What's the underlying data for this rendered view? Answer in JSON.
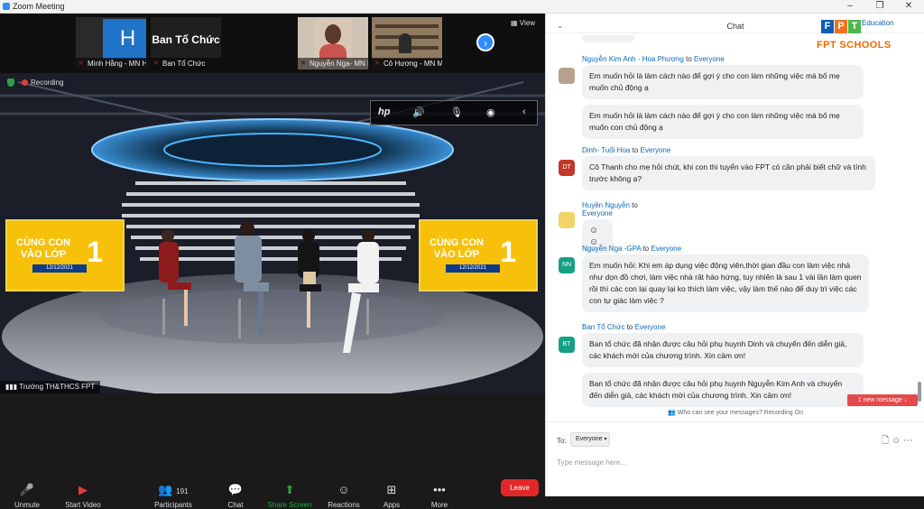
{
  "window": {
    "title": "Zoom Meeting",
    "minimize": "–",
    "maximize": "❐",
    "close": "✕"
  },
  "participants_strip": {
    "tiles": [
      {
        "name": "Minh Hằng - MN Hoa ...",
        "initial": "H"
      },
      {
        "name": "Ban Tổ Chức",
        "label": "Ban Tổ Chức"
      },
      {
        "name": "Nguyễn Nga- MN Mai ..."
      },
      {
        "name": "Cô Hương - MN Mai D..."
      }
    ],
    "next_icon": "›",
    "view_label": "View"
  },
  "main_video": {
    "recording_label": "Recording",
    "hp_icon": "hp",
    "panel_text": "CÙNG CON VÀO LỚP",
    "panel_number": "1",
    "panel_date": "12/12/2021",
    "speaker_name": "Trường TH&THCS FPT"
  },
  "toolbar": {
    "unmute": "Unmute",
    "start_video": "Start Video",
    "participants": "Participants",
    "participants_count": "191",
    "chat": "Chat",
    "share_screen": "Share Screen",
    "reactions": "Reactions",
    "apps": "Apps",
    "more": "More",
    "leave": "Leave"
  },
  "chat": {
    "title": "Chat",
    "brand": {
      "letters": [
        "F",
        "P",
        "T"
      ],
      "edu": "Education",
      "schools": "FPT SCHOOLS"
    },
    "to_word": "to",
    "messages": [
      {
        "sender": "Nguyễn Kim Anh - Hoa Phượng",
        "to": "Everyone",
        "bubbles": [
          "Em muốn hỏi là làm cách nào để gợi ý cho con làm những việc mà bố mẹ muốn chủ động ạ",
          "Em muốn hỏi là làm cách nào để gợi ý cho con làm những việc mà bố mẹ muốn con chủ động ạ"
        ]
      },
      {
        "sender": "Dinh- Tuổi Hoa",
        "to": "Everyone",
        "avatar": "DT",
        "bubbles": [
          "Cô Thanh cho mẹ hỏi chút, khi con thi tuyển vào FPT có cần phải biết chữ và tính trước không ạ?"
        ]
      },
      {
        "sender": "Huyền Nguyễn",
        "to": "Everyone",
        "bubbles": [
          "☺☺"
        ]
      },
      {
        "sender": "Nguyễn Nga -GPA",
        "to": "Everyone",
        "avatar": "NN",
        "bubbles": [
          "Em muốn hỏi: Khi em áp dụng việc động viên,thời gian đầu con làm việc nhà như dọn đồ chơi, làm việc nhà rất hào hứng, tuy nhiên là sau 1 vài lần làm quen rồi thì các con lại quay lại ko thích làm việc, vậy làm thế nào để duy trì việc các con tự giác làm việc ?"
        ]
      },
      {
        "sender": "Ban Tổ Chức",
        "to": "Everyone",
        "avatar": "BT",
        "bubbles": [
          "Ban tổ chức đã nhận được câu hỏi phụ huynh Dinh và chuyển đến diễn giả, các khách mời của chương trình. Xin cảm ơn!",
          "Ban tổ chức đã nhận được câu hỏi phụ huynh Nguyễn Kim Anh và chuyển đến diễn giả, các khách mời của chương trình. Xin cảm ơn!"
        ]
      }
    ],
    "new_message": "1 new message ↓",
    "who_can_see": "Who can see your messages? Recording On",
    "to_label": "To:",
    "to_value": "Everyone",
    "placeholder": "Type message here..."
  }
}
